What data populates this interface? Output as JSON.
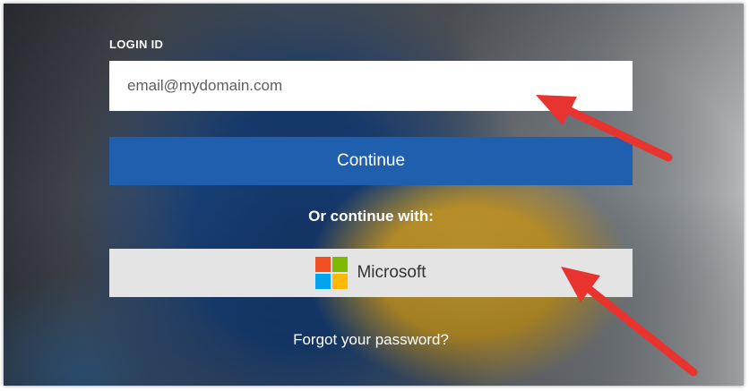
{
  "login": {
    "label": "LOGIN ID",
    "email_placeholder": "email@mydomain.com",
    "continue_label": "Continue",
    "or_text": "Or continue with:",
    "microsoft_label": "Microsoft",
    "forgot_label": "Forgot your password?"
  },
  "colors": {
    "continue_button": "#1f5fae",
    "microsoft_button": "#e4e4e4",
    "arrow": "#e8332e",
    "ms_red": "#f25022",
    "ms_green": "#7fba00",
    "ms_blue": "#00a4ef",
    "ms_yellow": "#ffb900"
  },
  "icons": [
    "microsoft-logo-icon",
    "annotation-arrow"
  ]
}
